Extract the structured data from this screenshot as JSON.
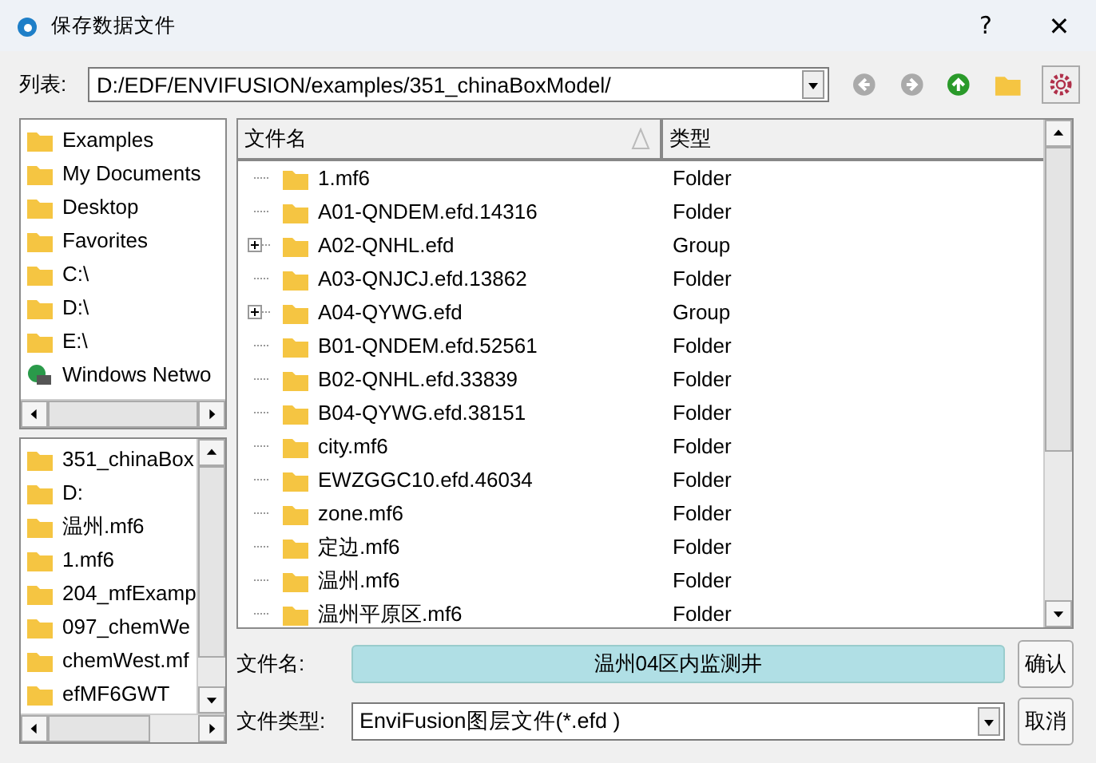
{
  "window": {
    "title": "保存数据文件",
    "help": "?",
    "close": "✕"
  },
  "path_bar": {
    "label": "列表:",
    "value": "D:/EDF/ENVIFUSION/examples/351_chinaBoxModel/"
  },
  "places": [
    {
      "label": "Examples",
      "kind": "folder"
    },
    {
      "label": "My Documents",
      "kind": "folder"
    },
    {
      "label": "Desktop",
      "kind": "folder"
    },
    {
      "label": "Favorites",
      "kind": "folder"
    },
    {
      "label": "C:\\",
      "kind": "folder"
    },
    {
      "label": "D:\\",
      "kind": "folder"
    },
    {
      "label": "E:\\",
      "kind": "folder"
    },
    {
      "label": "Windows Netwo",
      "kind": "network"
    }
  ],
  "history": [
    {
      "label": "351_chinaBox"
    },
    {
      "label": "D:"
    },
    {
      "label": "温州.mf6"
    },
    {
      "label": "1.mf6"
    },
    {
      "label": "204_mfExamp"
    },
    {
      "label": "097_chemWe"
    },
    {
      "label": "chemWest.mf"
    },
    {
      "label": "efMF6GWT"
    }
  ],
  "table": {
    "columns": [
      "文件名",
      "类型"
    ],
    "rows": [
      {
        "name": "1.mf6",
        "type": "Folder",
        "expandable": false
      },
      {
        "name": "A01-QNDEM.efd.14316",
        "type": "Folder",
        "expandable": false
      },
      {
        "name": "A02-QNHL.efd",
        "type": "Group",
        "expandable": true
      },
      {
        "name": "A03-QNJCJ.efd.13862",
        "type": "Folder",
        "expandable": false
      },
      {
        "name": "A04-QYWG.efd",
        "type": "Group",
        "expandable": true
      },
      {
        "name": "B01-QNDEM.efd.52561",
        "type": "Folder",
        "expandable": false
      },
      {
        "name": "B02-QNHL.efd.33839",
        "type": "Folder",
        "expandable": false
      },
      {
        "name": "B04-QYWG.efd.38151",
        "type": "Folder",
        "expandable": false
      },
      {
        "name": "city.mf6",
        "type": "Folder",
        "expandable": false
      },
      {
        "name": "EWZGGC10.efd.46034",
        "type": "Folder",
        "expandable": false
      },
      {
        "name": "zone.mf6",
        "type": "Folder",
        "expandable": false
      },
      {
        "name": "定边.mf6",
        "type": "Folder",
        "expandable": false
      },
      {
        "name": "温州.mf6",
        "type": "Folder",
        "expandable": false
      },
      {
        "name": "温州平原区.mf6",
        "type": "Folder",
        "expandable": false
      }
    ]
  },
  "file_name": {
    "label": "文件名:",
    "value": "温州04区内监测井"
  },
  "file_type": {
    "label": "文件类型:",
    "value": "EnviFusion图层文件(*.efd )"
  },
  "buttons": [
    "确认",
    "取消"
  ]
}
